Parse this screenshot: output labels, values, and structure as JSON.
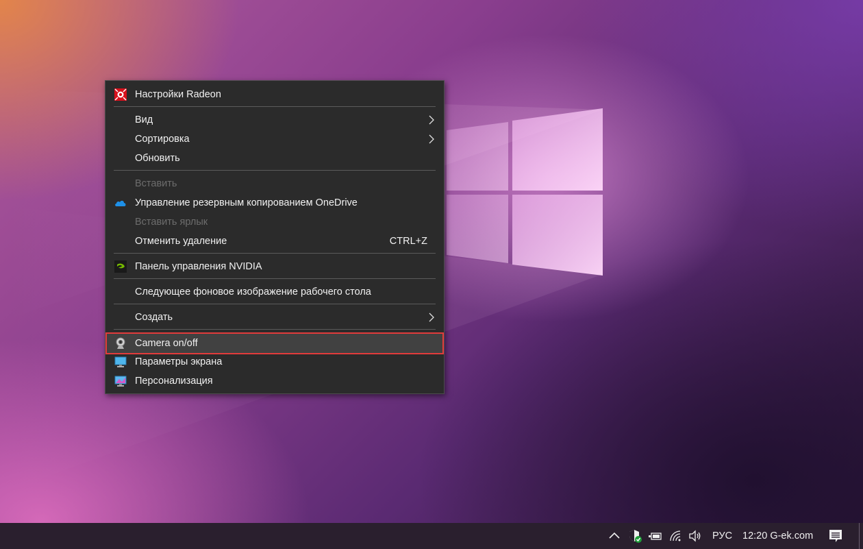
{
  "context_menu": {
    "items": [
      {
        "label": "Настройки Radeon",
        "icon": "radeon-icon"
      },
      {
        "label": "Вид",
        "submenu": true
      },
      {
        "label": "Сортировка",
        "submenu": true
      },
      {
        "label": "Обновить"
      },
      {
        "label": "Вставить",
        "disabled": true
      },
      {
        "label": "Управление резервным копированием OneDrive",
        "icon": "onedrive-icon"
      },
      {
        "label": "Вставить ярлык",
        "disabled": true
      },
      {
        "label": "Отменить удаление",
        "shortcut": "CTRL+Z"
      },
      {
        "label": "Панель управления NVIDIA",
        "icon": "nvidia-icon"
      },
      {
        "label": "Следующее фоновое изображение рабочего стола"
      },
      {
        "label": "Создать",
        "submenu": true
      },
      {
        "label": "Camera on/off",
        "icon": "webcam-icon",
        "highlighted": true
      },
      {
        "label": "Параметры экрана",
        "icon": "display-icon"
      },
      {
        "label": "Персонализация",
        "icon": "personalize-icon"
      }
    ]
  },
  "taskbar": {
    "language": "РУС",
    "clock": "12:20 G-ek.com",
    "icons": [
      "chevron-up-icon",
      "defender-icon",
      "battery-icon",
      "wifi-icon",
      "volume-icon",
      "notification-icon"
    ]
  },
  "colors": {
    "menu_bg": "#2b2b2b",
    "highlight_border": "#e23b3b"
  }
}
